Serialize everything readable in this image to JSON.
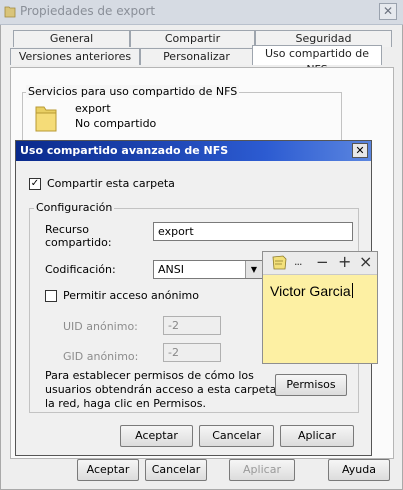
{
  "back_window": {
    "title": "Propiedades de export",
    "tabs_row1": [
      "General",
      "Compartir",
      "Seguridad"
    ],
    "tabs_row2": [
      "Versiones anteriores",
      "Personalizar",
      "Uso compartido de NFS"
    ],
    "services_group": "Servicios para uso compartido de NFS",
    "share_name": "export",
    "share_status": "No compartido",
    "buttons": {
      "accept": "Aceptar",
      "cancel": "Cancelar",
      "apply": "Aplicar",
      "help": "Ayuda"
    }
  },
  "nfs_dialog": {
    "title": "Uso compartido avanzado de NFS",
    "share_checkbox_label": "Compartir esta carpeta",
    "share_checked": true,
    "config_group": "Configuración",
    "resource_label_line1": "Recurso",
    "resource_label_line2": "compartido:",
    "resource_value": "export",
    "encoding_label": "Codificación:",
    "encoding_value": "ANSI",
    "anon_checkbox_label": "Permitir acceso anónimo",
    "anon_checked": false,
    "uid_label": "UID anónimo:",
    "uid_value": "-2",
    "gid_label": "GID anónimo:",
    "gid_value": "-2",
    "permissions_text_1": "Para establecer permisos de cómo los",
    "permissions_text_2": "usuarios obtendrán acceso a esta carpeta en",
    "permissions_text_3": "la red, haga clic en Permisos.",
    "permissions_button": "Permisos",
    "buttons": {
      "accept": "Aceptar",
      "cancel": "Cancelar",
      "apply": "Aplicar"
    }
  },
  "sticky_note": {
    "text": "Victor Garcia",
    "controls": {
      "more": "...",
      "minimize": "−",
      "add": "+",
      "close": "×"
    }
  },
  "colors": {
    "dialog_title_start": "#0a2a8c",
    "dialog_title_end": "#5b86e0",
    "sticky_bg": "#fdf0a3"
  }
}
